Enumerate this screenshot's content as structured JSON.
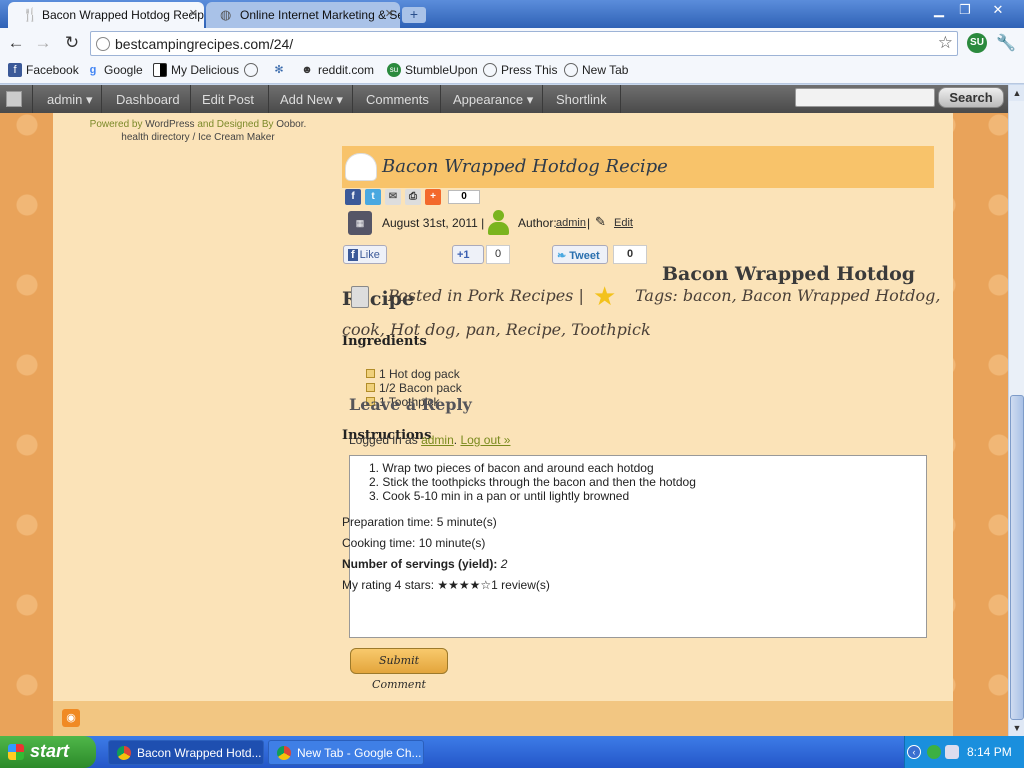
{
  "browser": {
    "tabs": [
      {
        "title": "Bacon Wrapped Hotdog Recipe",
        "active": true
      },
      {
        "title": "Online Internet Marketing & Se",
        "active": false
      }
    ],
    "url": "bestcampingrecipes.com/24/",
    "bookmarks": [
      "Facebook",
      "Google",
      "My Delicious",
      "",
      "",
      "reddit.com",
      "StumbleUpon",
      "Press This",
      "New Tab"
    ]
  },
  "adminbar": {
    "items": [
      "admin ▾",
      "Dashboard",
      "Edit Post",
      "Add New ▾",
      "Comments",
      "Appearance ▾",
      "Shortlink"
    ],
    "search_button": "Search",
    "search_placeholder": ""
  },
  "sidebar": {
    "powered_prefix": "Powered by",
    "powered_wp": "WordPress",
    "powered_and": "and Designed By",
    "powered_by": "Oobor.",
    "links": "health directory / Ice Cream Maker"
  },
  "post": {
    "title": "Bacon Wrapped Hotdog Recipe",
    "share_count": "0",
    "date": "August 31st, 2011 |",
    "author_label": "Author:",
    "author": "admin",
    "author_sep": "|",
    "edit": "Edit",
    "like": "Like",
    "plusone": "+1",
    "plusone_count": "0",
    "tweet": "Tweet",
    "tweet_count": "0",
    "heading_line1": "Bacon Wrapped Hotdog",
    "heading_line2": "Recipe",
    "posted_in": "Posted in Pork Recipes |",
    "tags_line1": "Tags: bacon, Bacon Wrapped Hotdog,",
    "tags_line2": "cook, Hot dog, pan, Recipe, Toothpick",
    "ingredients_title": "Ingredients",
    "ingredients": [
      "1 Hot dog pack",
      "1/2 Bacon pack",
      "1 Toothpick"
    ],
    "instructions_title": "Instructions",
    "instructions": [
      "1. Wrap two pieces of bacon and around each hotdog",
      "2. Stick the toothpicks through the bacon and then the hotdog",
      "3. Cook 5-10 min in a pan or until lightly browned"
    ],
    "prep_time": "Preparation time: 5 minute(s)",
    "cook_time": "Cooking time: 10 minute(s)",
    "servings_label": "Number of servings (yield):",
    "servings_value": "2",
    "rating_label": "My rating 4 stars:",
    "rating_stars": "★★★★☆",
    "rating_reviews": "1 review(s)"
  },
  "comments": {
    "leave_reply": "Leave a Reply",
    "logged_in_as": "Logged in as",
    "user": "admin",
    "logout": "Log out »",
    "submit": "Submit Comment"
  },
  "taskbar": {
    "start": "start",
    "tasks": [
      "Bacon Wrapped Hotd...",
      "New Tab - Google Ch..."
    ],
    "clock": "8:14 PM"
  },
  "colors": {
    "page_bg": "#e9a35a",
    "content_bg": "#fbe3b8",
    "title_bar": "#f8c36a",
    "admin_bar": "#555555"
  }
}
